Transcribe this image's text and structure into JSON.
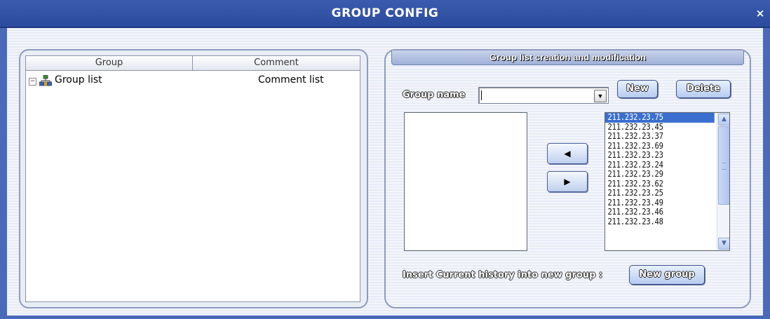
{
  "window": {
    "title": "GROUP CONFIG",
    "close_glyph": "×"
  },
  "left_panel": {
    "columns": [
      "Group",
      "Comment"
    ],
    "tree": {
      "toggle_glyph": "−",
      "label": "Group list",
      "comment": "Comment list",
      "icon": "network-group-icon"
    }
  },
  "right_panel": {
    "header": "Group list creation and modification",
    "group_name_label": "Group name",
    "group_name_value": "",
    "new_button": "New",
    "delete_button": "Delete",
    "move_left_glyph": "◀",
    "move_right_glyph": "▶",
    "ip_list": [
      "211.232.23.75",
      "211.232.23.45",
      "211.232.23.37",
      "211.232.23.69",
      "211.232.23.23",
      "211.232.23.24",
      "211.232.23.29",
      "211.232.23.62",
      "211.232.23.25",
      "211.232.23.49",
      "211.232.23.46",
      "211.232.23.48"
    ],
    "selected_ip_index": 0,
    "insert_label": "Insert Current history into new group :",
    "new_group_button": "New group"
  },
  "colors": {
    "title_bar": "#2b4b9d",
    "selection": "#3a6fd0",
    "button_border": "#3a4f8a"
  }
}
